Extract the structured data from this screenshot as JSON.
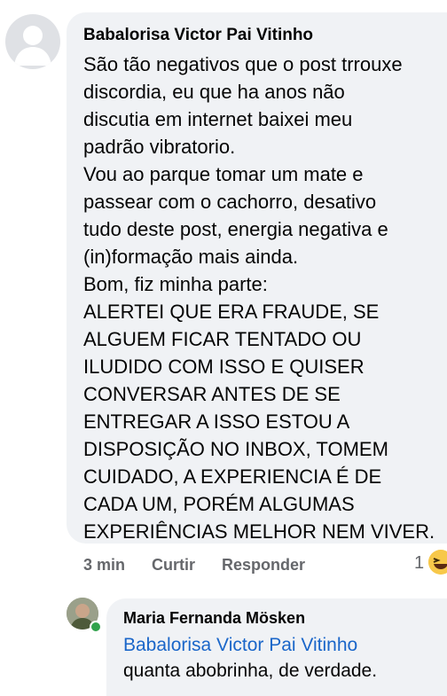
{
  "comment": {
    "author": "Babalorisa Victor Pai Vitinho",
    "text": "São tão negativos que o post trrouxe\ndiscordia, eu que ha anos não\ndiscutia em internet baixei meu\npadrão vibratorio.\nVou ao parque tomar um mate e\npassear com o cachorro, desativo\ntudo deste post, energia negativa e\n(in)formação mais ainda.\nBom, fiz minha parte:\nALERTEI QUE ERA FRAUDE, SE\nALGUEM FICAR TENTADO OU\nILUDIDO COM ISSO E QUISER\nCONVERSAR ANTES DE SE\nENTREGAR A ISSO ESTOU A\nDISPOSIÇÃO NO INBOX, TOMEM\nCUIDADO, A EXPERIENCIA É DE\nCADA UM, PORÉM ALGUMAS\nEXPERIÊNCIAS MELHOR NEM VIVER.",
    "time": "3 min",
    "like_label": "Curtir",
    "reply_label": "Responder",
    "reaction_count": "1",
    "reaction_icon": "haha-emoji-icon"
  },
  "reply": {
    "author": "Maria Fernanda Mösken",
    "mention": "Babalorisa Victor Pai Vitinho",
    "text": "quanta abobrinha, de verdade."
  },
  "colors": {
    "bubble": "#f0f2f5",
    "meta": "#65676b",
    "mention": "#1a66c9",
    "online": "#31a24c"
  }
}
